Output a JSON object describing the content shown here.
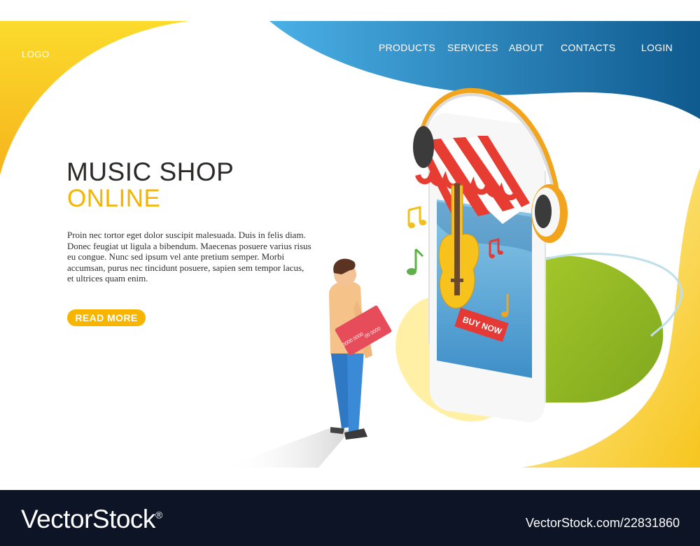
{
  "header": {
    "logo": "LOGO",
    "nav": [
      "PRODUCTS",
      "SERVICES",
      "ABOUT",
      "CONTACTS"
    ],
    "login": "LOGIN"
  },
  "hero": {
    "title_line1": "MUSIC SHOP",
    "title_line2": "ONLINE",
    "body": "Proin nec tortor eget dolor suscipit malesuada. Duis in felis diam. Donec feugiat ut ligula a bibendum. Maecenas posuere varius risus eu congue. Nunc sed ipsum vel ante pretium semper. Morbi accumsan, purus nec tincidunt posuere, sapien sem tempor lacus, et ultrices quam enim.",
    "cta": "READ MORE"
  },
  "illustration": {
    "buy_now": "BUY NOW",
    "card_number_1": "0000 0000",
    "card_number_2": "00 0000"
  },
  "footer": {
    "brand": "VectorStock",
    "registered_mark": "®",
    "stock_id": "VectorStock.com/22831860"
  },
  "colors": {
    "blue_dark": "#0f5a8f",
    "blue_light": "#4ab0e6",
    "yellow": "#f9d21e",
    "orange": "#f2a51c",
    "red": "#e53935",
    "footer_bg": "#0d1425"
  }
}
